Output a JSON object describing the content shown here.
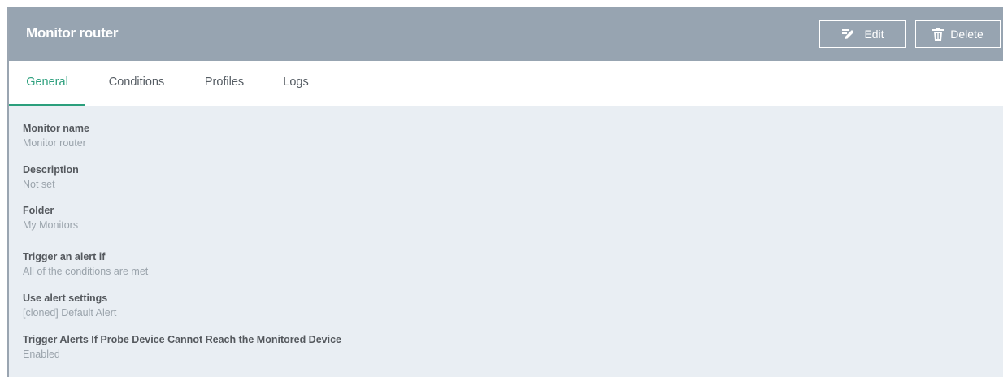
{
  "header": {
    "title": "Monitor router",
    "edit_label": "Edit",
    "delete_label": "Delete",
    "background": "#97a4b1"
  },
  "tabs": [
    {
      "label": "General",
      "active": true
    },
    {
      "label": "Conditions",
      "active": false
    },
    {
      "label": "Profiles",
      "active": false
    },
    {
      "label": "Logs",
      "active": false
    }
  ],
  "accent_color": "#2b9f7c",
  "fields": [
    {
      "label": "Monitor name",
      "value": "Monitor router"
    },
    {
      "label": "Description",
      "value": "Not set"
    },
    {
      "label": "Folder",
      "value": "My Monitors"
    },
    {
      "label": "Trigger an alert if",
      "value": "All of the conditions are met"
    },
    {
      "label": "Use alert settings",
      "value": "[cloned] Default Alert"
    },
    {
      "label": "Trigger Alerts If Probe Device Cannot Reach the Monitored Device",
      "value": "Enabled"
    }
  ]
}
